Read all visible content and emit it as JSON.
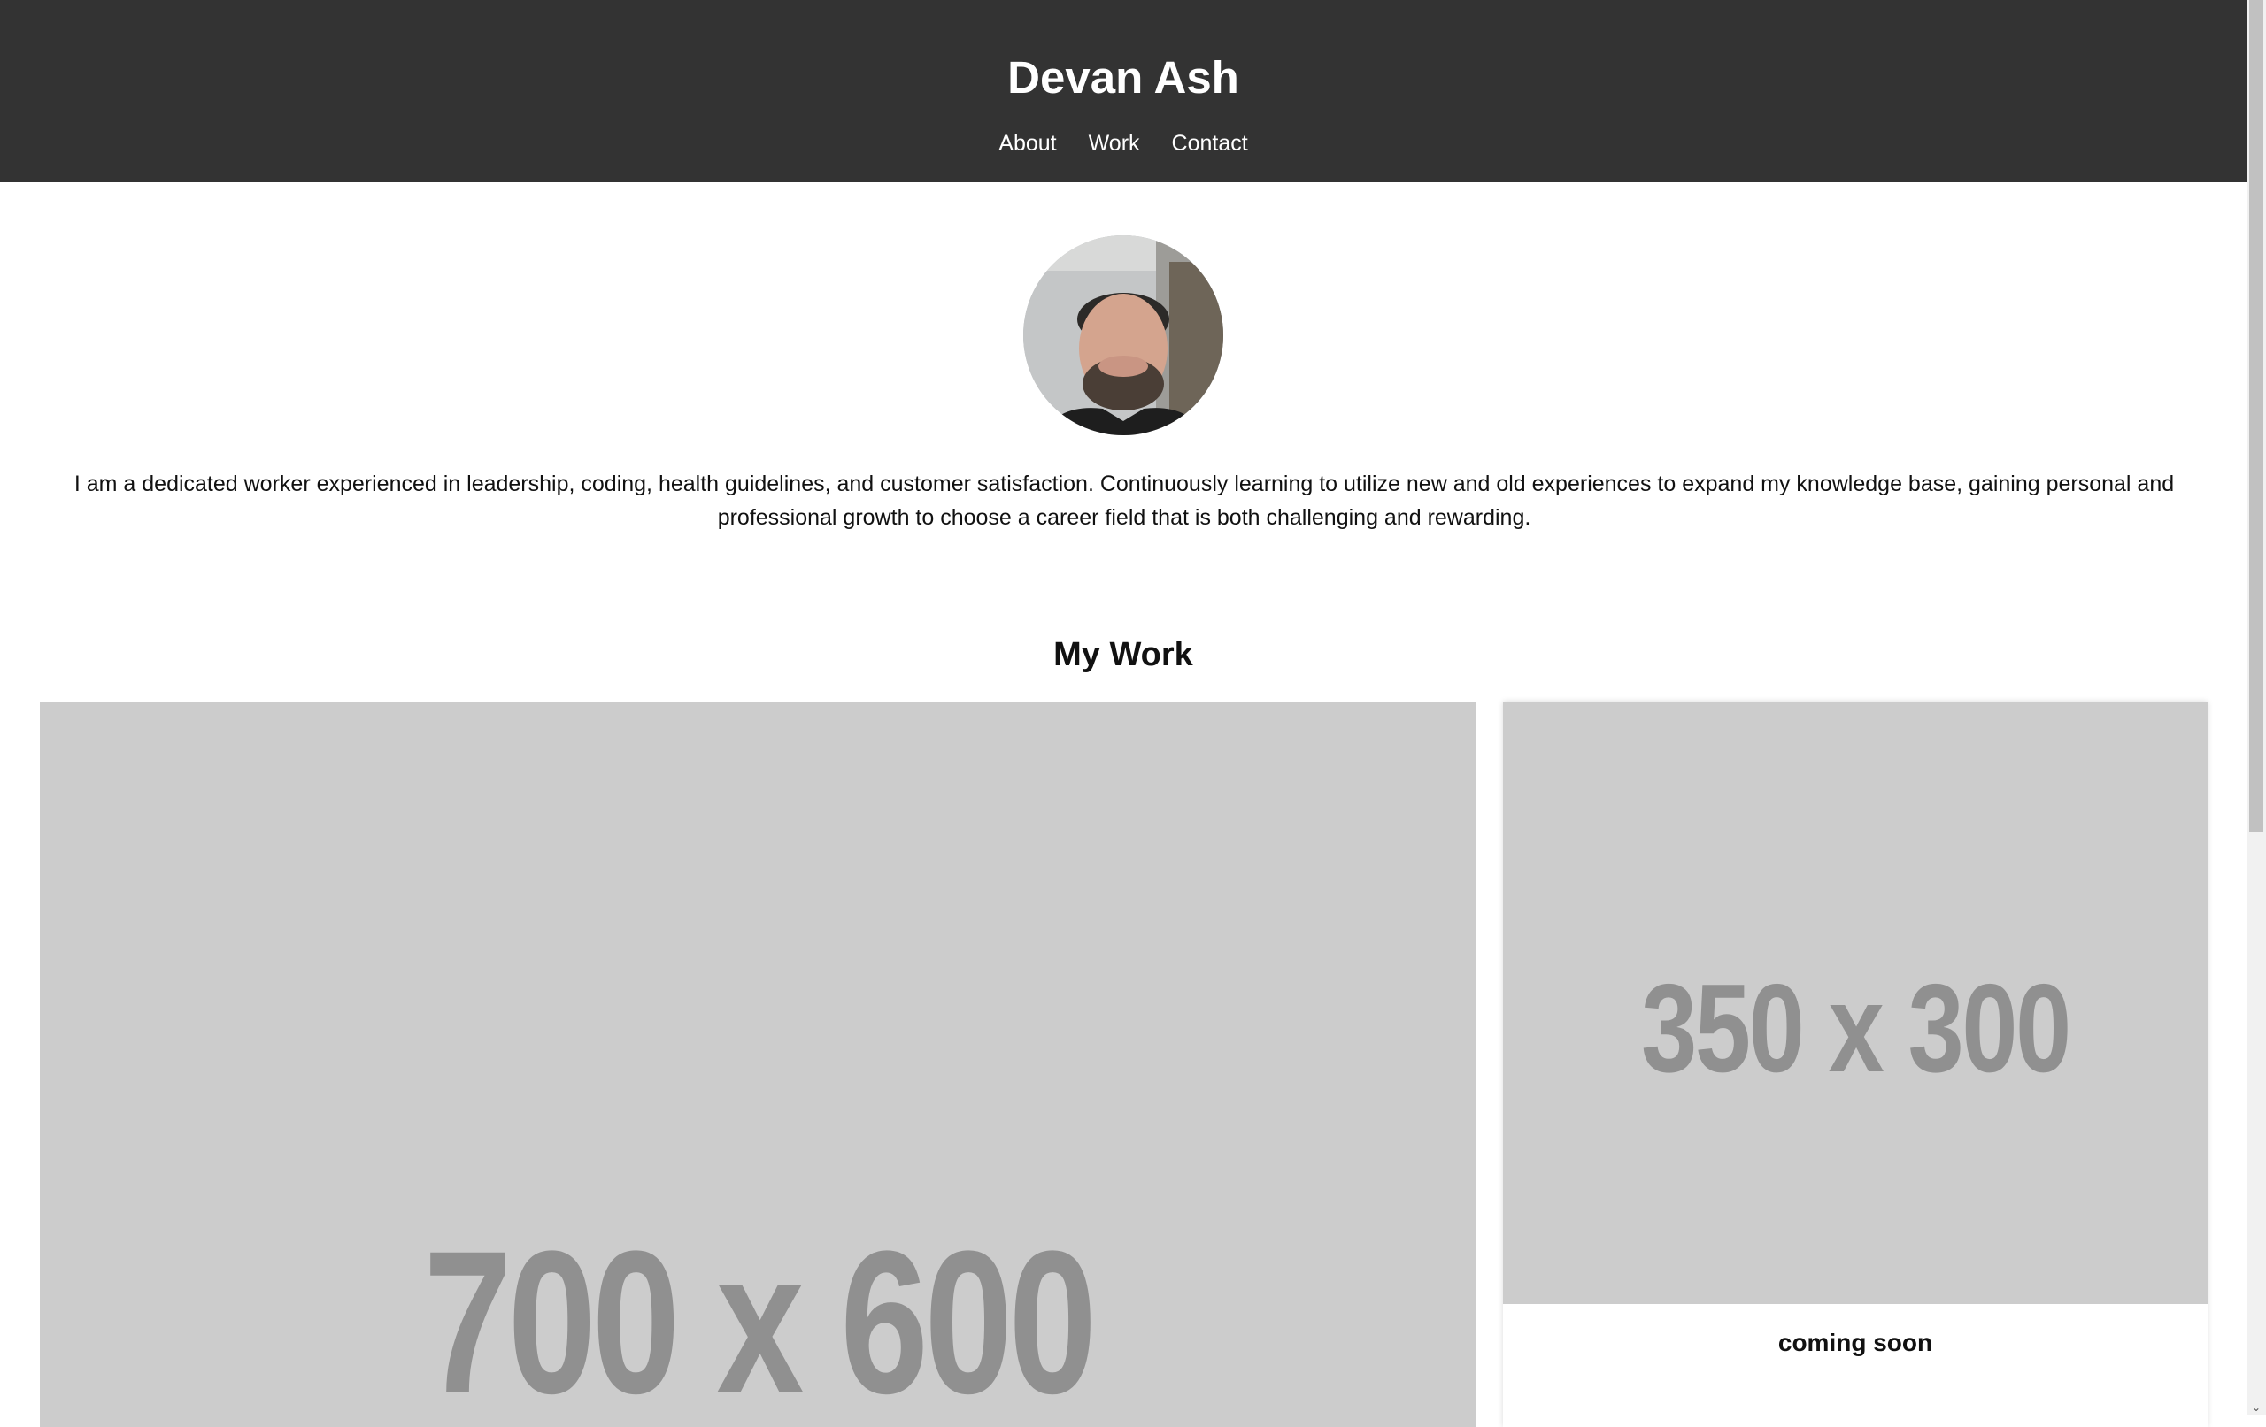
{
  "header": {
    "title": "Devan Ash",
    "nav": [
      "About",
      "Work",
      "Contact"
    ]
  },
  "about": {
    "avatar_alt": "profile photo",
    "text": "I am a dedicated worker experienced in leadership, coding, health guidelines, and customer satisfaction. Continuously learning to utilize new and old experiences to expand my knowledge base, gaining personal and professional growth to choose a career field that is both challenging and rewarding."
  },
  "work": {
    "heading": "My Work",
    "cards": [
      {
        "placeholder": "700 x 600",
        "caption": ""
      },
      {
        "placeholder": "350 x 300",
        "caption": "coming soon"
      }
    ]
  },
  "colors": {
    "header_bg": "#333333",
    "placeholder_bg": "#cccccc",
    "placeholder_text": "#909090"
  },
  "icons": {
    "scroll_down": "chevron-down-icon"
  }
}
